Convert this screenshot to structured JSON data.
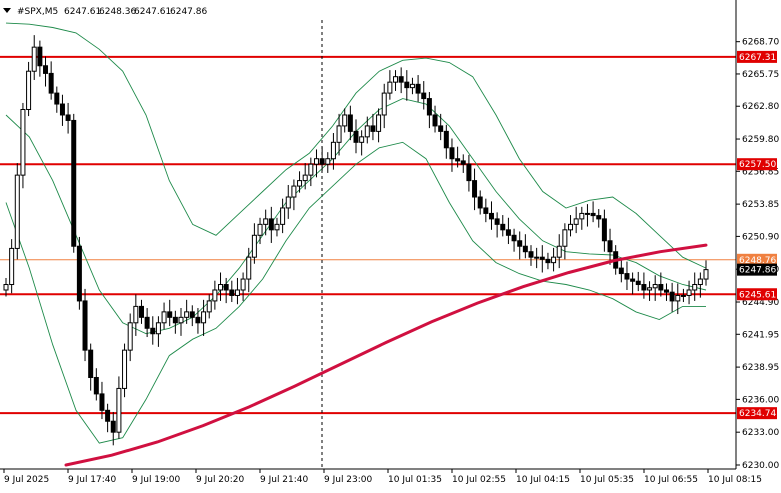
{
  "header": {
    "symbol": "#SPX,M5",
    "open": "6247.61",
    "high": "6248.36",
    "low": "6247.61",
    "close": "6247.86"
  },
  "chart_data": {
    "type": "candlestick",
    "ylim": [
      6230.0,
      6270.5
    ],
    "y_ticks": [
      "6268.70",
      "6265.75",
      "6262.80",
      "6259.80",
      "6256.85",
      "6253.85",
      "6250.90",
      "6247.90",
      "6244.90",
      "6241.95",
      "6238.95",
      "6236.00",
      "6233.00",
      "6230.00"
    ],
    "x_ticks": [
      "9 Jul 2025",
      "9 Jul 17:40",
      "9 Jul 19:00",
      "9 Jul 20:20",
      "9 Jul 21:40",
      "9 Jul 23:00",
      "10 Jul 01:35",
      "10 Jul 02:55",
      "10 Jul 04:15",
      "10 Jul 05:35",
      "10 Jul 06:55",
      "10 Jul 08:15"
    ],
    "levels": [
      {
        "value": 6267.31,
        "label": "6267.31",
        "color": "#e00000"
      },
      {
        "value": 6257.5,
        "label": "6257.50",
        "color": "#e00000"
      },
      {
        "value": 6245.61,
        "label": "6245.61",
        "color": "#e00000"
      },
      {
        "value": 6234.74,
        "label": "6234.74",
        "color": "#e00000"
      },
      {
        "value": 6248.76,
        "label": "6248.76",
        "color": "#f08040"
      }
    ],
    "current_price": {
      "value": 6247.86,
      "label": "6247.86"
    },
    "session_separator_x_tick": "9 Jul 23:00",
    "series": [
      {
        "indicator": "candles",
        "color": "#000000",
        "close": [
          6246.5,
          6249.8,
          6256.5,
          6262.5,
          6266.0,
          6268.2,
          6266.5,
          6265.8,
          6264.0,
          6263.0,
          6262.0,
          6261.5,
          6250.0,
          6245.0,
          6240.5,
          6238.0,
          6236.5,
          6235.0,
          6234.0,
          6233.0,
          6237.0,
          6240.5,
          6243.0,
          6244.5,
          6243.5,
          6242.5,
          6242.0,
          6243.0,
          6244.0,
          6243.5,
          6243.0,
          6243.5,
          6244.0,
          6243.5,
          6243.0,
          6244.0,
          6245.0,
          6246.0,
          6246.5,
          6246.0,
          6245.5,
          6246.0,
          6247.0,
          6249.0,
          6251.0,
          6252.0,
          6252.5,
          6251.5,
          6252.0,
          6253.5,
          6254.5,
          6255.5,
          6256.0,
          6256.5,
          6257.5,
          6258.0,
          6257.5,
          6258.0,
          6259.5,
          6261.0,
          6262.0,
          6260.5,
          6259.5,
          6260.0,
          6261.0,
          6260.5,
          6262.0,
          6264.0,
          6265.0,
          6265.5,
          6265.0,
          6264.5,
          6264.8,
          6264.0,
          6263.5,
          6262.0,
          6261.0,
          6260.5,
          6259.0,
          6258.0,
          6257.8,
          6257.5,
          6256.0,
          6254.5,
          6253.5,
          6253.0,
          6252.5,
          6252.0,
          6251.5,
          6251.0,
          6250.5,
          6250.0,
          6249.5,
          6249.0,
          6249.0,
          6248.8,
          6248.5,
          6249.0,
          6250.0,
          6251.5,
          6252.0,
          6252.5,
          6253.0,
          6253.0,
          6252.8,
          6252.5,
          6250.5,
          6249.5,
          6248.0,
          6247.5,
          6247.0,
          6246.8,
          6246.5,
          6246.0,
          6246.2,
          6246.5,
          6246.0,
          6245.8,
          6245.0,
          6245.5,
          6245.5,
          6246.0,
          6246.5,
          6247.0,
          6247.86
        ]
      },
      {
        "indicator": "ema",
        "color": "#d01040",
        "values": [
          6230.0,
          6230.9,
          6232.1,
          6233.6,
          6235.3,
          6237.2,
          6239.2,
          6241.2,
          6243.1,
          6244.8,
          6246.3,
          6247.6,
          6248.7,
          6249.5,
          6250.1
        ]
      },
      {
        "indicator": "bb-upper",
        "color": "#1e8a4a",
        "values": [
          6270.4,
          6270.3,
          6270.0,
          6269.5,
          6268.0,
          6266.0,
          6262.0,
          6256.0,
          6252.0,
          6251.0,
          6253.0,
          6255.0,
          6257.0,
          6258.5,
          6261.0,
          6264.0,
          6266.0,
          6267.0,
          6267.2,
          6266.8,
          6265.5,
          6262.0,
          6258.0,
          6255.0,
          6253.5,
          6254.2,
          6254.5,
          6253.0,
          6251.0,
          6249.0,
          6248.0
        ]
      },
      {
        "indicator": "bb-middle",
        "color": "#1e8a4a",
        "values": [
          6262.0,
          6260.0,
          6256.0,
          6251.0,
          6246.0,
          6243.0,
          6242.0,
          6242.5,
          6243.5,
          6245.5,
          6248.0,
          6251.0,
          6254.0,
          6256.0,
          6258.0,
          6260.5,
          6262.5,
          6263.5,
          6263.0,
          6261.0,
          6258.0,
          6255.0,
          6252.5,
          6250.5,
          6249.5,
          6249.3,
          6249.2,
          6248.5,
          6247.3,
          6246.5,
          6246.0
        ]
      },
      {
        "indicator": "bb-lower",
        "color": "#1e8a4a",
        "values": [
          6254.0,
          6248.0,
          6241.0,
          6235.0,
          6232.0,
          6232.5,
          6236.0,
          6240.0,
          6241.5,
          6242.5,
          6244.5,
          6247.0,
          6250.5,
          6253.5,
          6255.5,
          6257.5,
          6259.0,
          6259.5,
          6258.0,
          6254.0,
          6250.5,
          6248.5,
          6247.5,
          6246.8,
          6246.5,
          6246.0,
          6245.2,
          6244.0,
          6243.3,
          6244.5,
          6244.5
        ]
      }
    ]
  }
}
